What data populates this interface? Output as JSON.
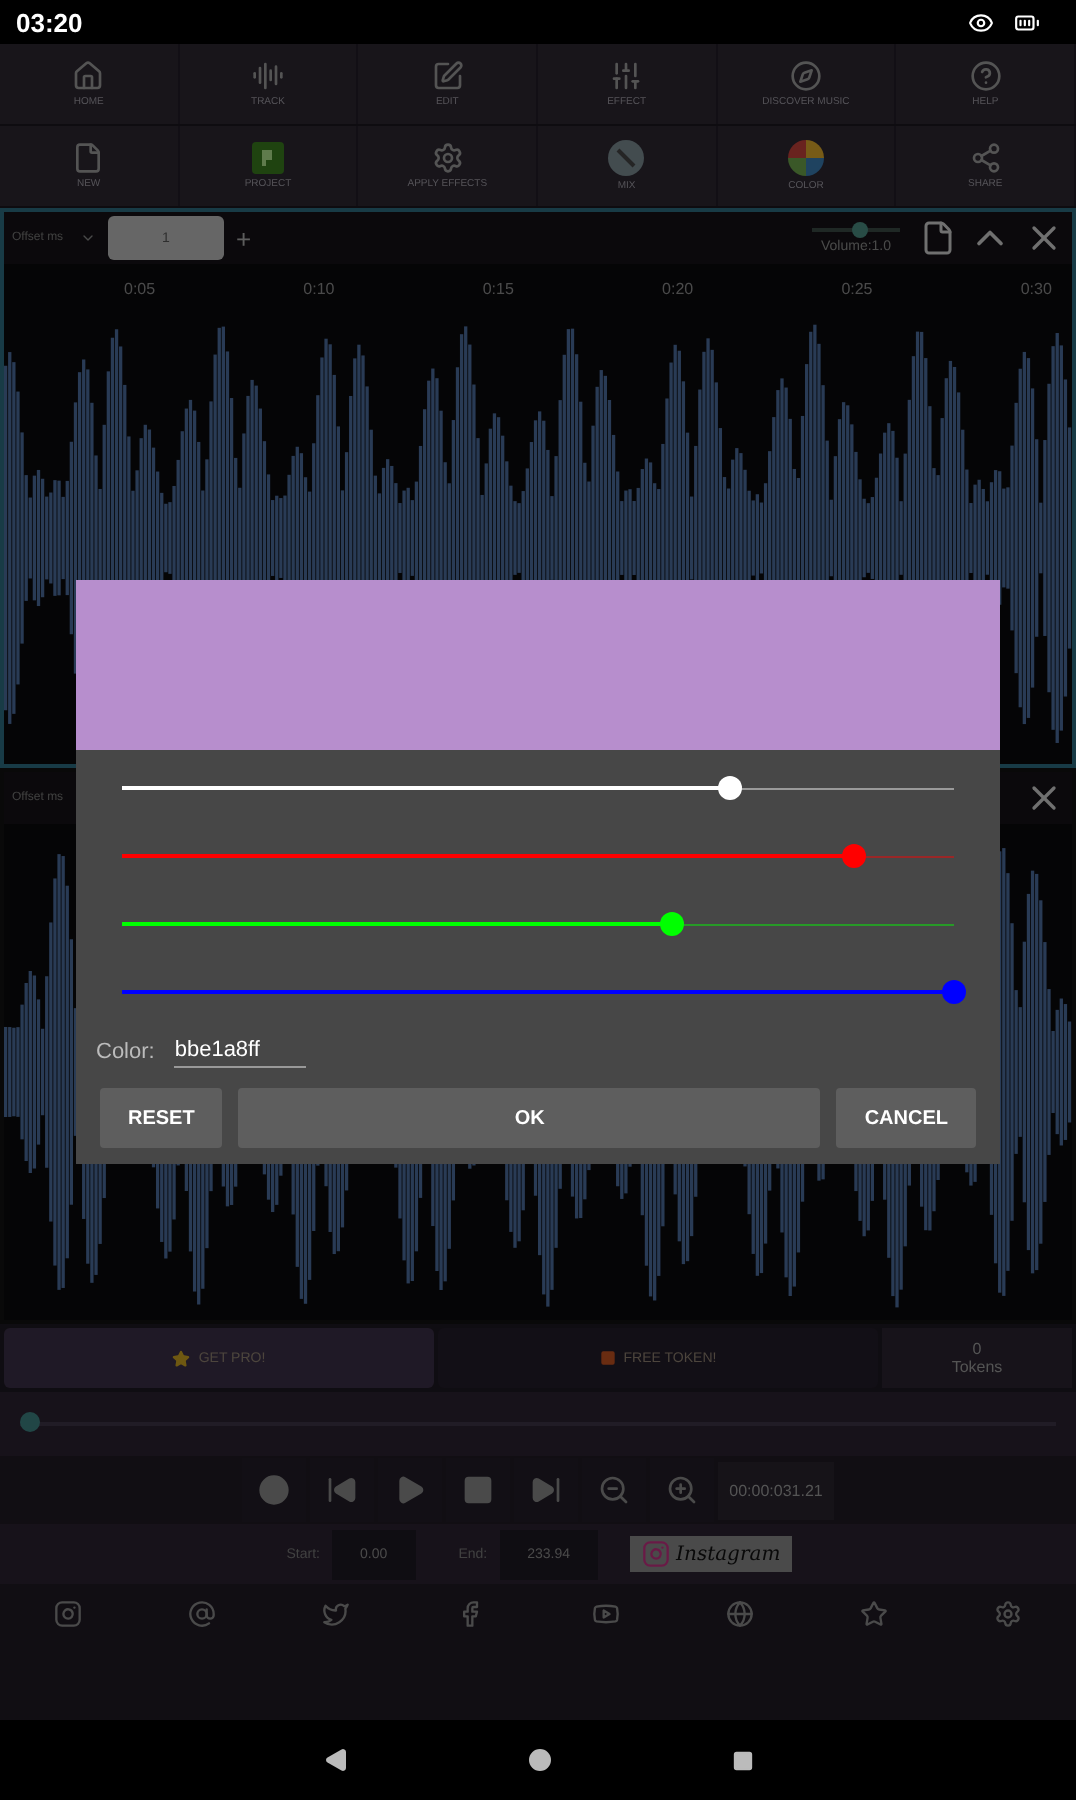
{
  "status_bar": {
    "time": "03:20"
  },
  "toolbar": [
    {
      "label": "HOME"
    },
    {
      "label": "TRACK"
    },
    {
      "label": "EDIT"
    },
    {
      "label": "EFFECT"
    },
    {
      "label": "DISCOVER MUSIC"
    },
    {
      "label": "HELP"
    }
  ],
  "toolbar_2": [
    {
      "label": "NEW"
    },
    {
      "label": "PROJECT"
    },
    {
      "label": "APPLY EFFECTS"
    },
    {
      "label": "MIX"
    },
    {
      "label": "COLOR"
    },
    {
      "label": "SHARE"
    }
  ],
  "track": {
    "offset_label": "Offset ms",
    "tab": "1",
    "add": "+",
    "volume": "Volume:1.0",
    "volume_slider": {
      "level": 0.55
    },
    "ticks": [
      "0:05",
      "0:10",
      "0:15",
      "0:20",
      "0:25",
      "0:30"
    ]
  },
  "track_2": {
    "offset_label": "Offset ms"
  },
  "color_dialog": {
    "sliders": [
      {
        "color": "#ffffff",
        "level": 0.73
      },
      {
        "color": "#ff0000",
        "level": 0.88
      },
      {
        "color": "#00ff00",
        "level": 0.66
      },
      {
        "color": "#0000ff",
        "level": 1
      }
    ],
    "field_label": "Color:",
    "value": "bbe1a8ff",
    "buttons": [
      "RESET",
      "OK",
      "CANCEL"
    ]
  },
  "promo": {
    "pro": "GET PRO!",
    "token": "FREE TOKEN!",
    "count": "0",
    "count_label": "Tokens"
  },
  "seek": {
    "level": 0.01
  },
  "transport": {
    "time": "00:00:031.21"
  },
  "range": {
    "start_label": "Start:",
    "start": "0.00",
    "end_label": "End:",
    "end": "233.94",
    "instagram": "Instagram"
  }
}
